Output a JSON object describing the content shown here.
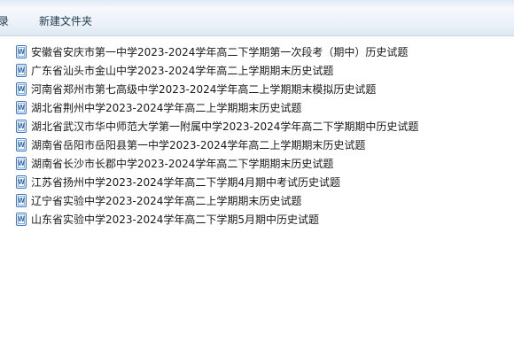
{
  "toolbar": {
    "items": [
      {
        "label": "目录",
        "visible_text": "录"
      },
      {
        "label": "新建文件夹"
      }
    ]
  },
  "icons": {
    "file": "word-document-icon"
  },
  "files": [
    {
      "name": "安徽省安庆市第一中学2023-2024学年高二下学期第一次段考（期中）历史试题"
    },
    {
      "name": "广东省汕头市金山中学2023-2024学年高二上学期期末历史试题"
    },
    {
      "name": "河南省郑州市第七高级中学2023-2024学年高二上学期期末模拟历史试题"
    },
    {
      "name": "湖北省荆州中学2023-2024学年高二上学期期末历史试题"
    },
    {
      "name": "湖北省武汉市华中师范大学第一附属中学2023-2024学年高二下学期期中历史试题"
    },
    {
      "name": "湖南省岳阳市岳阳县第一中学2023-2024学年高二上学期期末历史试题"
    },
    {
      "name": "湖南省长沙市长郡中学2023-2024学年高二下学期期末历史试题"
    },
    {
      "name": "江苏省扬州中学2023-2024学年高二下学期4月期中考试历史试题"
    },
    {
      "name": "辽宁省实验中学2023-2024学年高二上学期期末历史试题"
    },
    {
      "name": "山东省实验中学2023-2024学年高二下学期5月期中历史试题"
    }
  ]
}
